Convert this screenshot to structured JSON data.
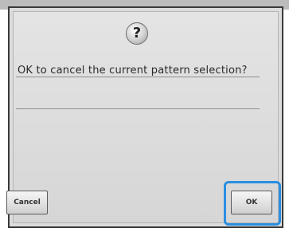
{
  "dialog": {
    "icon": "question-icon",
    "icon_glyph": "?",
    "message": "OK to cancel the current pattern selection?"
  },
  "buttons": {
    "cancel_label": "Cancel",
    "ok_label": "OK"
  },
  "colors": {
    "highlight": "#2a8fe0",
    "dialog_background": "#dcdcdc"
  }
}
